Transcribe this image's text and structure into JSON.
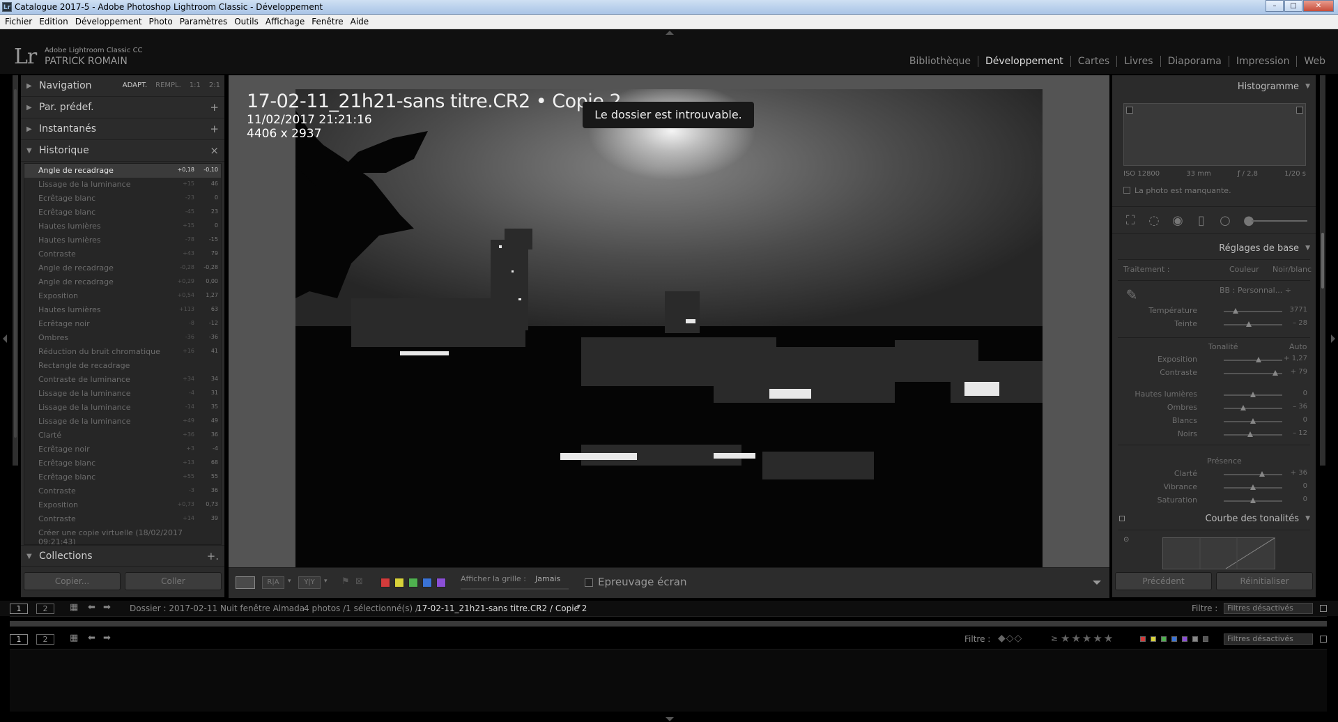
{
  "window": {
    "title": "Catalogue 2017-5 - Adobe Photoshop Lightroom Classic - Développement",
    "icon_text": "Lr",
    "minimize": "–",
    "maximize": "□",
    "close": "✕"
  },
  "menu": [
    "Fichier",
    "Edition",
    "Développement",
    "Photo",
    "Paramètres",
    "Outils",
    "Affichage",
    "Fenêtre",
    "Aide"
  ],
  "identity": {
    "logo": "Lr",
    "product": "Adobe Lightroom Classic CC",
    "user": "PATRICK ROMAIN"
  },
  "modules": [
    "Bibliothèque",
    "Développement",
    "Cartes",
    "Livres",
    "Diaporama",
    "Impression",
    "Web"
  ],
  "active_module": "Développement",
  "left": {
    "navigation": {
      "label": "Navigation",
      "zoom": [
        "ADAPT.",
        "REMPL.",
        "1:1",
        "2:1"
      ],
      "zoom_selected": "ADAPT."
    },
    "presets": {
      "label": "Par. prédef.",
      "action": "+"
    },
    "snapshots": {
      "label": "Instantanés",
      "action": "+"
    },
    "history": {
      "label": "Historique",
      "action": "×",
      "items": [
        {
          "name": "Angle de recadrage",
          "delta": "+0,18",
          "value": "-0,10"
        },
        {
          "name": "Lissage de la luminance",
          "delta": "+15",
          "value": "46"
        },
        {
          "name": "Ecrêtage blanc",
          "delta": "-23",
          "value": "0"
        },
        {
          "name": "Ecrêtage blanc",
          "delta": "-45",
          "value": "23"
        },
        {
          "name": "Hautes lumières",
          "delta": "+15",
          "value": "0"
        },
        {
          "name": "Hautes lumières",
          "delta": "-78",
          "value": "-15"
        },
        {
          "name": "Contraste",
          "delta": "+43",
          "value": "79"
        },
        {
          "name": "Angle de recadrage",
          "delta": "-0,28",
          "value": "-0,28"
        },
        {
          "name": "Angle de recadrage",
          "delta": "+0,29",
          "value": "0,00"
        },
        {
          "name": "Exposition",
          "delta": "+0,54",
          "value": "1,27"
        },
        {
          "name": "Hautes lumières",
          "delta": "+113",
          "value": "63"
        },
        {
          "name": "Ecrêtage noir",
          "delta": "-8",
          "value": "-12"
        },
        {
          "name": "Ombres",
          "delta": "-36",
          "value": "-36"
        },
        {
          "name": "Réduction du bruit chromatique",
          "delta": "+16",
          "value": "41"
        },
        {
          "name": "Rectangle de recadrage",
          "delta": "",
          "value": ""
        },
        {
          "name": "Contraste de luminance",
          "delta": "+34",
          "value": "34"
        },
        {
          "name": "Lissage de la luminance",
          "delta": "-4",
          "value": "31"
        },
        {
          "name": "Lissage de la luminance",
          "delta": "-14",
          "value": "35"
        },
        {
          "name": "Lissage de la luminance",
          "delta": "+49",
          "value": "49"
        },
        {
          "name": "Clarté",
          "delta": "+36",
          "value": "36"
        },
        {
          "name": "Ecrêtage noir",
          "delta": "+3",
          "value": "-4"
        },
        {
          "name": "Ecrêtage blanc",
          "delta": "+13",
          "value": "68"
        },
        {
          "name": "Ecrêtage blanc",
          "delta": "+55",
          "value": "55"
        },
        {
          "name": "Contraste",
          "delta": "-3",
          "value": "36"
        },
        {
          "name": "Exposition",
          "delta": "+0,73",
          "value": "0,73"
        },
        {
          "name": "Contraste",
          "delta": "+14",
          "value": "39"
        },
        {
          "name": "Créer une copie virtuelle (18/02/2017 09:21:43)",
          "delta": "",
          "value": ""
        }
      ],
      "selected_index": 0
    },
    "collections": {
      "label": "Collections",
      "action": "+."
    },
    "copy_button": "Copier...",
    "paste_button": "Coller"
  },
  "photo": {
    "filename": "17-02-11_21h21-sans titre.CR2  •  Copie 2",
    "datetime": "11/02/2017 21:21:16",
    "dimensions": "4406 x 2937",
    "toast": "Le dossier est introuvable."
  },
  "toolbar": {
    "view_button": "",
    "before_after_ra": "R|A",
    "before_after_yy": "Y|Y",
    "grid_label": "Afficher la grille :",
    "grid_value": "Jamais",
    "proof_label": "Epreuvage écran",
    "colors": [
      "#d23b3b",
      "#d8d23a",
      "#4fb04f",
      "#3a73d6",
      "#8b4fd6"
    ]
  },
  "right": {
    "histogram": {
      "label": "Histogramme",
      "iso": "ISO 12800",
      "focal": "33 mm",
      "aperture": "ƒ / 2,8",
      "shutter": "1/20 s",
      "missing": "La photo est manquante."
    },
    "basic": {
      "label": "Réglages de base",
      "treatment_label": "Traitement :",
      "treatment_color": "Couleur",
      "treatment_bw": "Noir/blanc",
      "wb_label": "BB :",
      "wb_value": "Personnal... ÷",
      "temperature": {
        "label": "Température",
        "value": "3771",
        "fraction": 0.2
      },
      "tint": {
        "label": "Teinte",
        "value": "– 28",
        "fraction": 0.43
      },
      "tone_label": "Tonalité",
      "auto_label": "Auto",
      "exposure": {
        "label": "Exposition",
        "value": "+ 1,27",
        "fraction": 0.6
      },
      "contrast": {
        "label": "Contraste",
        "value": "+ 79",
        "fraction": 0.88
      },
      "highlights": {
        "label": "Hautes lumières",
        "value": "0",
        "fraction": 0.5
      },
      "shadows": {
        "label": "Ombres",
        "value": "– 36",
        "fraction": 0.33
      },
      "whites": {
        "label": "Blancs",
        "value": "0",
        "fraction": 0.5
      },
      "blacks": {
        "label": "Noirs",
        "value": "– 12",
        "fraction": 0.45
      },
      "presence_label": "Présence",
      "clarity": {
        "label": "Clarté",
        "value": "+ 36",
        "fraction": 0.65
      },
      "vibrance": {
        "label": "Vibrance",
        "value": "0",
        "fraction": 0.5
      },
      "saturation": {
        "label": "Saturation",
        "value": "0",
        "fraction": 0.5
      }
    },
    "tone_curve": {
      "label": "Courbe des tonalités"
    },
    "previous_button": "Précédent",
    "reset_button": "Réinitialiser"
  },
  "filmstrip": {
    "page1": "1",
    "page2": "2",
    "folder": "Dossier : 2017-02-11 Nuit fenêtre Almada",
    "count": "4 photos /1 sélectionné(s) /",
    "current": "17-02-11_21h21-sans titre.CR2 / Copie 2",
    "filter_label": "Filtre :",
    "filter_value": "Filtres désactivés",
    "rating_op": "≥",
    "stars": "★★★★★"
  }
}
